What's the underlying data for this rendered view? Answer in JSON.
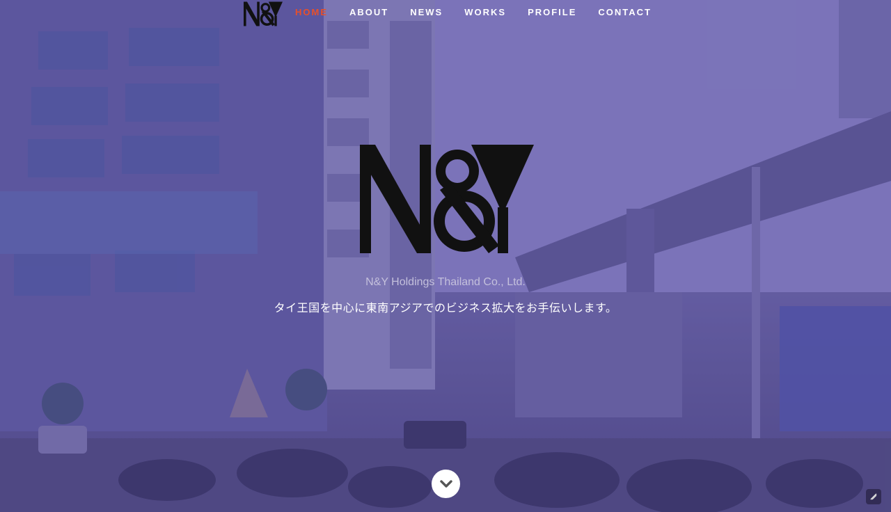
{
  "nav": {
    "brand_logo": "N&Y",
    "items": [
      {
        "label": "HOME",
        "active": true
      },
      {
        "label": "ABOUT",
        "active": false
      },
      {
        "label": "NEWS",
        "active": false
      },
      {
        "label": "WORKS",
        "active": false
      },
      {
        "label": "PROFILE",
        "active": false
      },
      {
        "label": "CONTACT",
        "active": false
      }
    ],
    "active_color": "#e8502a"
  },
  "hero": {
    "logo": "N&Y",
    "company": "N&Y Holdings Thailand Co., Ltd.",
    "tagline": "タイ王国を中心に東南アジアでのビジネス拡大をお手伝いします。",
    "scroll_icon": "chevron-down-icon",
    "tint_color": "#584ea8"
  },
  "icons": {
    "scroll": "chevron-down-icon",
    "corner": "feather-icon"
  }
}
